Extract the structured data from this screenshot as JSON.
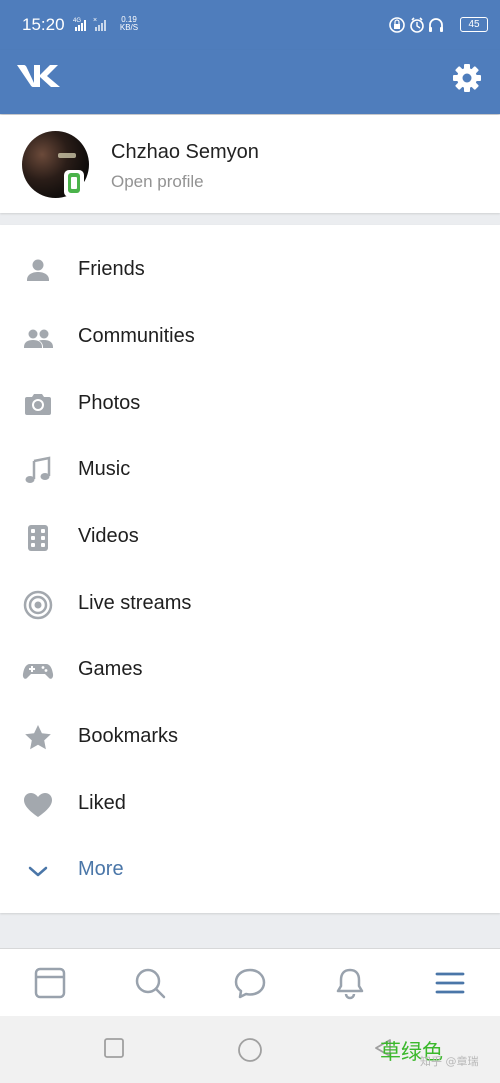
{
  "status_bar": {
    "time": "15:20",
    "network_label": "4G",
    "speed_value": "0.19",
    "speed_unit": "KB/S",
    "battery": "45"
  },
  "header": {
    "logo_icon": "vk-logo-icon",
    "settings_icon": "gear-icon"
  },
  "profile": {
    "name": "Chzhao Semyon",
    "subtitle": "Open profile"
  },
  "menu": {
    "items": [
      {
        "label": "Friends",
        "icon": "person-icon"
      },
      {
        "label": "Communities",
        "icon": "people-icon"
      },
      {
        "label": "Photos",
        "icon": "camera-icon"
      },
      {
        "label": "Music",
        "icon": "music-note-icon"
      },
      {
        "label": "Videos",
        "icon": "film-icon"
      },
      {
        "label": "Live streams",
        "icon": "live-target-icon"
      },
      {
        "label": "Games",
        "icon": "gamepad-icon"
      },
      {
        "label": "Bookmarks",
        "icon": "star-icon"
      },
      {
        "label": "Liked",
        "icon": "heart-icon"
      },
      {
        "label": "More",
        "icon": "chevron-down-icon"
      }
    ]
  },
  "tabbar": {
    "tabs": [
      {
        "icon": "news-feed-icon"
      },
      {
        "icon": "search-icon"
      },
      {
        "icon": "messages-icon"
      },
      {
        "icon": "notifications-bell-icon"
      },
      {
        "icon": "menu-icon",
        "active": true
      }
    ]
  },
  "system_nav": {
    "buttons": [
      "recents-square-icon",
      "home-circle-icon",
      "back-triangle-icon"
    ]
  },
  "watermark": {
    "text": "草绿色",
    "sub": "知乎 @章瑞"
  },
  "colors": {
    "header_blue": "#4f7dbc",
    "icon_gray": "#a3a8ae",
    "accent_blue": "#4a76a8",
    "online_green": "#4bb34b"
  }
}
